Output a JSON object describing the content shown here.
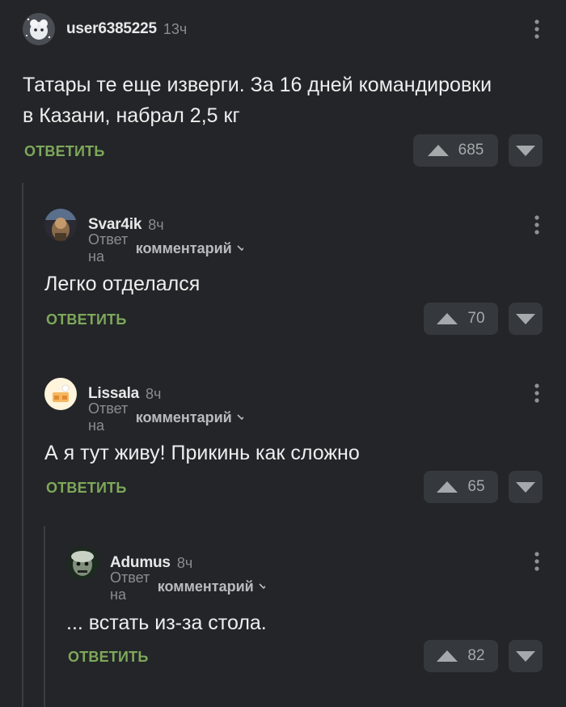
{
  "reply_label": "ОТВЕТИТЬ",
  "reply_to_prefix": "Ответ на",
  "reply_to_target": "комментарий",
  "comments": [
    {
      "user": "user6385225",
      "time": "13ч",
      "text_lines": [
        "Татары те еще изверги. За 16 дней командировки",
        "в Казани, набрал 2,5 кг"
      ],
      "rating": "685"
    },
    {
      "user": "Svar4ik",
      "time": "8ч",
      "text": "Легко отделался",
      "rating": "70"
    },
    {
      "user": "Lissala",
      "time": "8ч",
      "text": "А я тут живу! Прикинь как сложно",
      "rating": "65"
    },
    {
      "user": "Adumus",
      "time": "8ч",
      "text": "... встать из-за стола.",
      "rating": "82"
    }
  ],
  "colors": {
    "background": "#232528",
    "reply_green": "#7ea85a",
    "vote_bg": "#35383c",
    "thread_line": "#3a3d41"
  }
}
